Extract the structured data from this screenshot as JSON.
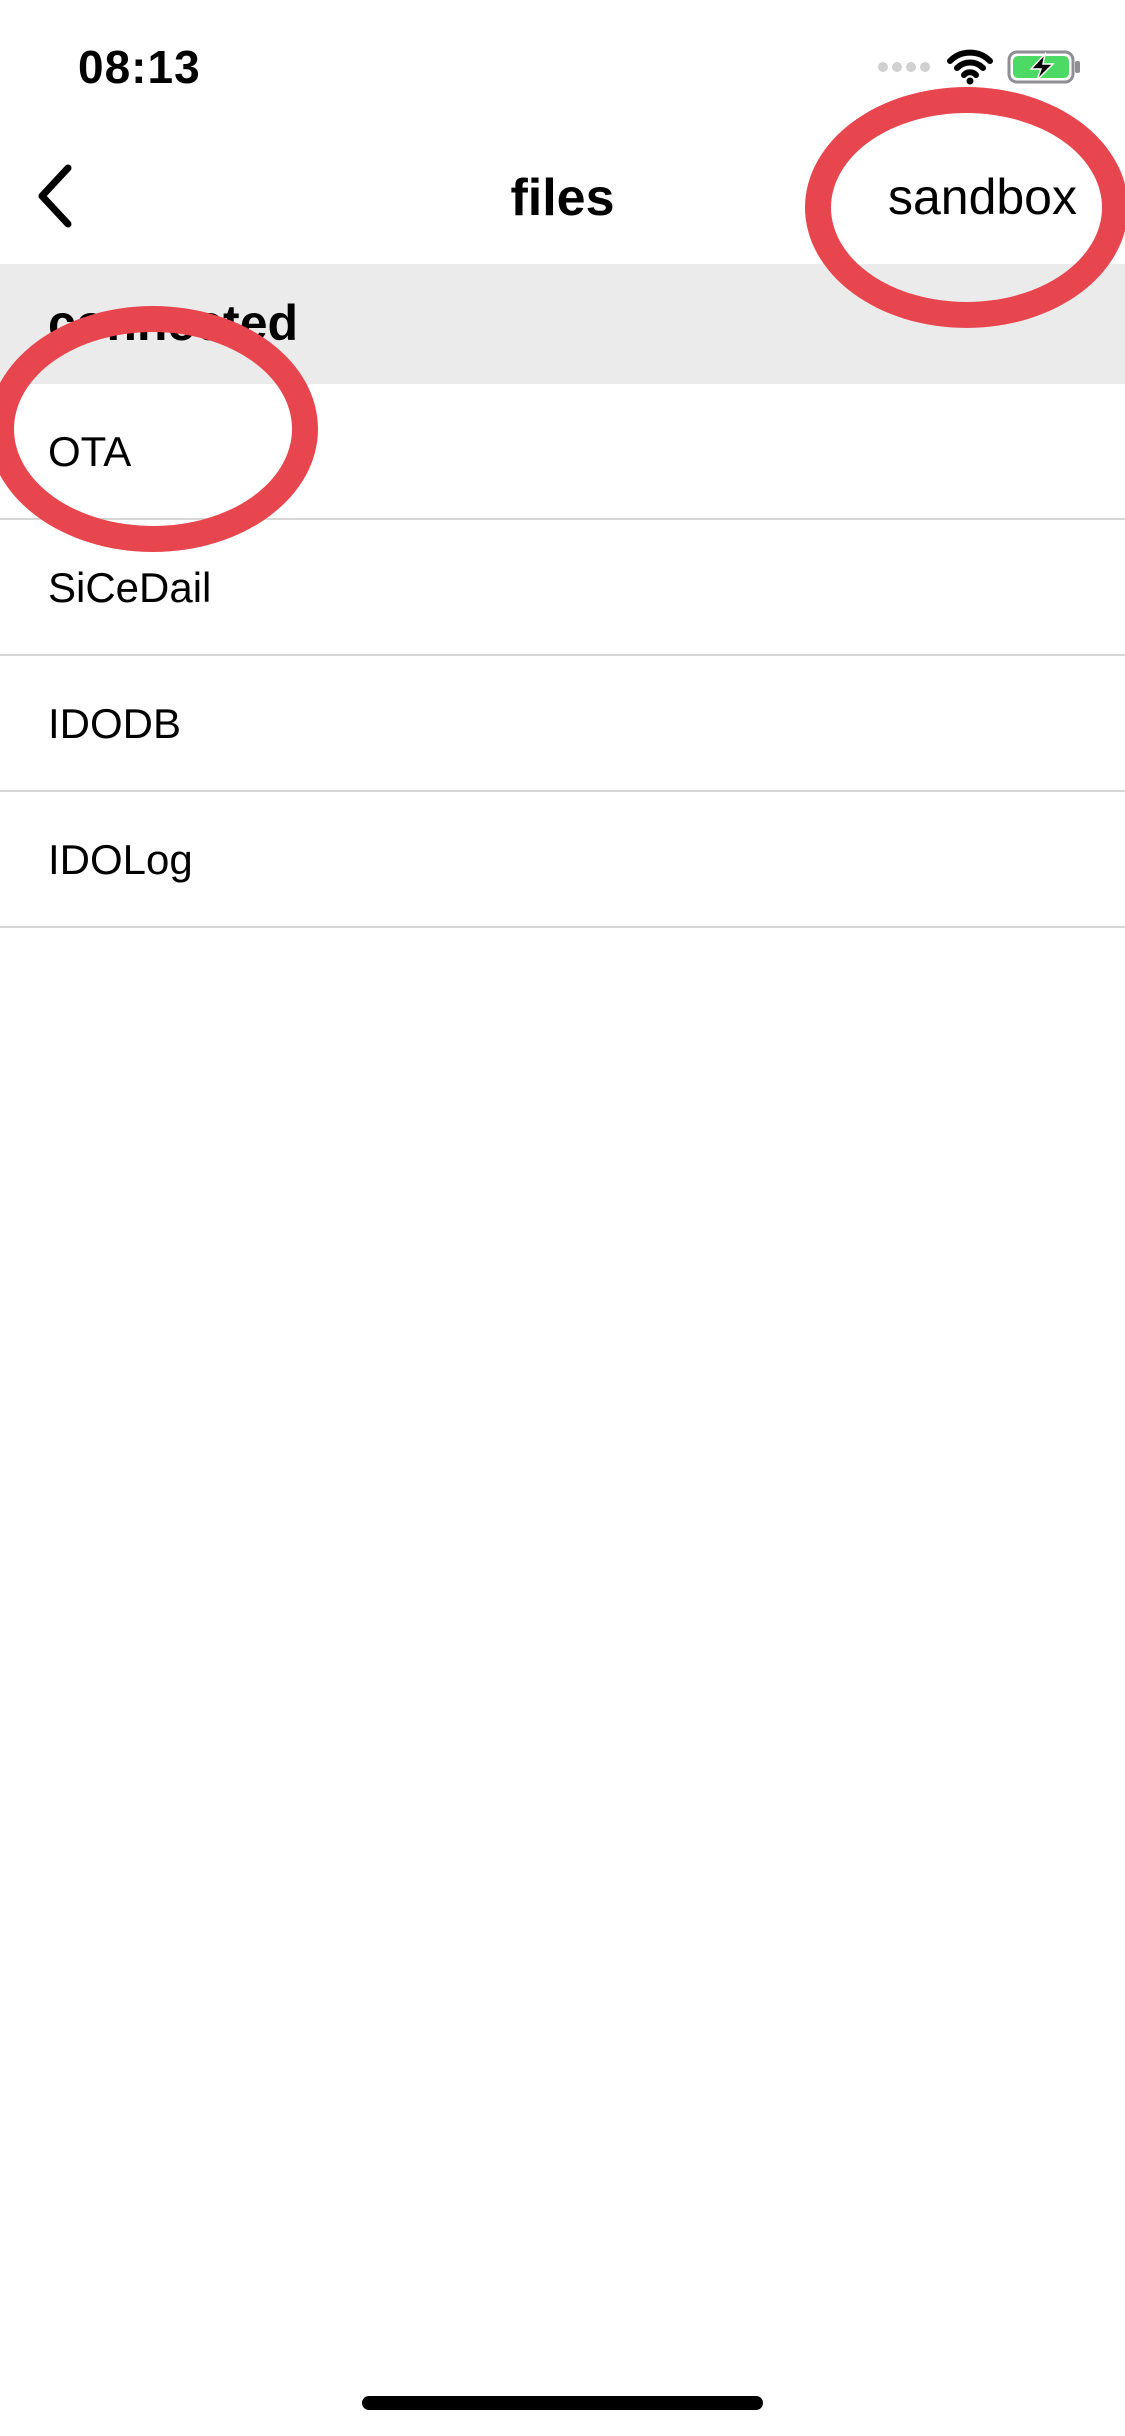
{
  "status_bar": {
    "time": "08:13",
    "icons": [
      "signal-dots-icon",
      "wifi-icon",
      "battery-charging-icon"
    ],
    "battery_color": "#4cd964"
  },
  "nav": {
    "back_icon": "chevron-left-icon",
    "title": "files",
    "right_button": "sandbox"
  },
  "section": {
    "header": "connected"
  },
  "files": [
    {
      "name": "OTA"
    },
    {
      "name": "SiCeDail"
    },
    {
      "name": "IDODB"
    },
    {
      "name": "IDOLog"
    }
  ],
  "annotation_color": "#e8464e"
}
